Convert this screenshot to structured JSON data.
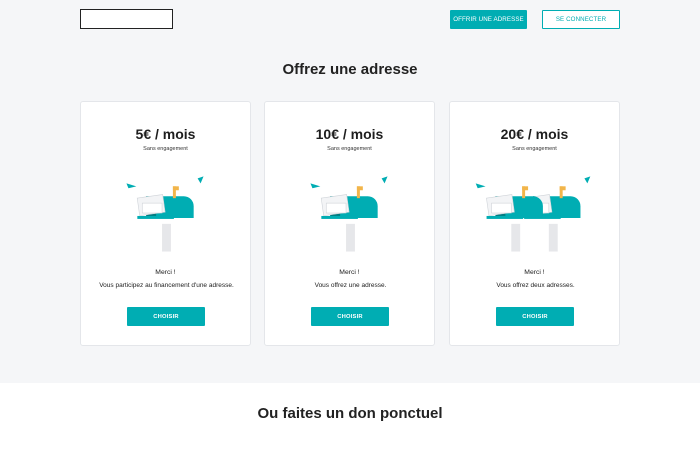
{
  "header": {
    "offer_button": "OFFRIR UNE ADRESSE",
    "login_button": "SE CONNECTER"
  },
  "main": {
    "title": "Offrez une adresse",
    "cards": [
      {
        "price": "5€ / mois",
        "subtitle": "Sans engagement",
        "thanks": "Merci !",
        "description": "Vous participez au financement d'une adresse.",
        "button": "CHOISIR",
        "mailboxes": 1
      },
      {
        "price": "10€ / mois",
        "subtitle": "Sans engagement",
        "thanks": "Merci !",
        "description": "Vous offrez une adresse.",
        "button": "CHOISIR",
        "mailboxes": 1
      },
      {
        "price": "20€ / mois",
        "subtitle": "Sans engagement",
        "thanks": "Merci !",
        "description": "Vous offrez deux adresses.",
        "button": "CHOISIR",
        "mailboxes": 2
      }
    ]
  },
  "donation": {
    "title": "Ou faites un don ponctuel"
  },
  "colors": {
    "accent": "#00adb3",
    "flag": "#f2b54a",
    "background": "#f5f6f8"
  }
}
